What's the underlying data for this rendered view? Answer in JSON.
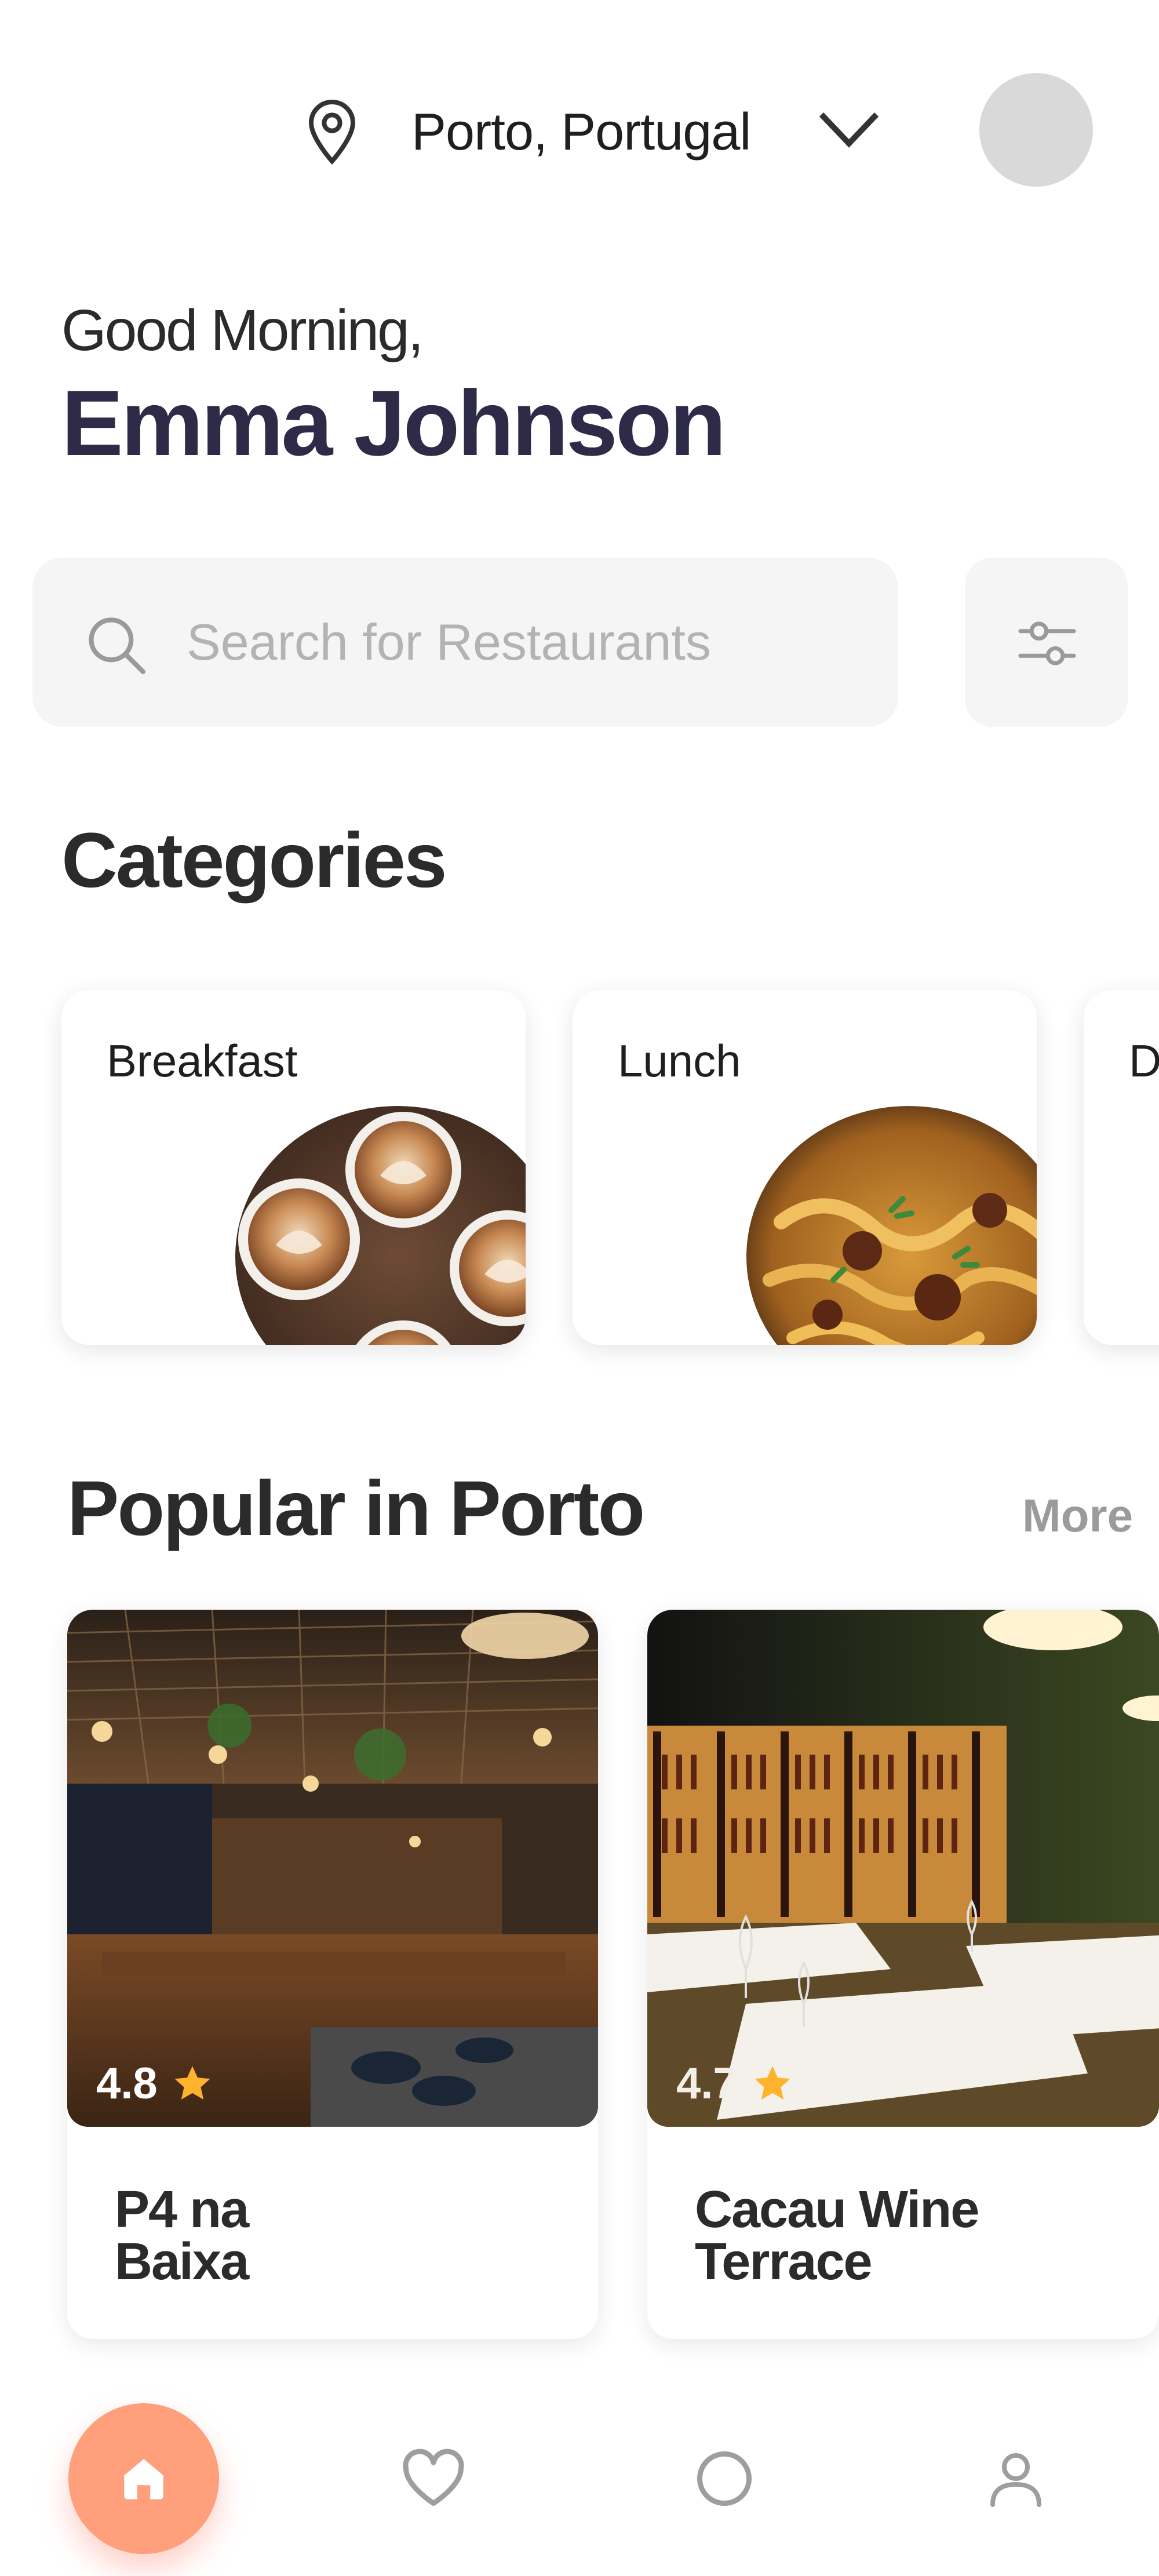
{
  "header": {
    "location": "Porto, Portugal",
    "location_icon": "map-pin-icon",
    "dropdown_icon": "chevron-down-icon",
    "avatar_icon": "avatar"
  },
  "greeting": {
    "salutation": "Good Morning,",
    "user_name": "Emma Johnson"
  },
  "search": {
    "placeholder": "Search for Restaurants",
    "value": "",
    "icon": "search-icon",
    "filter_icon": "filter-sliders-icon"
  },
  "categories": {
    "title": "Categories",
    "items": [
      {
        "label": "Breakfast",
        "image": "coffee-latte-art"
      },
      {
        "label": "Lunch",
        "image": "pasta-dish"
      },
      {
        "label": "D",
        "image": ""
      }
    ]
  },
  "popular": {
    "title": "Popular in Porto",
    "more_label": "More",
    "restaurants": [
      {
        "name_line1": "P4 na",
        "name_line2": "Baixa",
        "rating": "4.8",
        "image": "restaurant-interior-warm"
      },
      {
        "name_line1": "Cacau Wine",
        "name_line2": "Terrace",
        "rating": "4.7",
        "image": "wine-bar-interior"
      }
    ]
  },
  "nav": {
    "items": [
      {
        "icon": "home-icon",
        "active": true
      },
      {
        "icon": "heart-icon",
        "active": false
      },
      {
        "icon": "circle-icon",
        "active": false
      },
      {
        "icon": "user-icon",
        "active": false
      }
    ],
    "accent_color": "#ff9f7c"
  },
  "colors": {
    "name_text": "#2d2b47",
    "star": "#ffb22c",
    "panel_bg": "#f5f5f5"
  }
}
